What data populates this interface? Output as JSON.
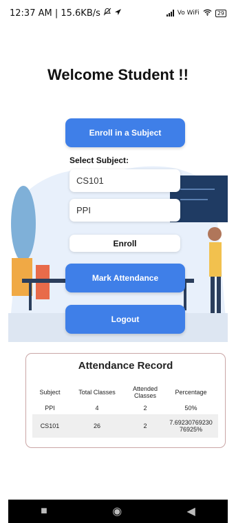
{
  "status_bar": {
    "time_speed": "12:37 AM | 15.6KB/s",
    "mute_icon": "bell-off-icon",
    "nav_arrow_icon": "navigation-arrow-icon",
    "vowifi": "Vo WiFi",
    "battery": "29"
  },
  "header": {
    "title": "Welcome Student !!"
  },
  "enroll_section": {
    "enroll_subject_label": "Enroll in a Subject",
    "select_subject_label": "Select Subject:",
    "subject_input_1": "CS101",
    "subject_input_2": "PPI",
    "enroll_label": "Enroll"
  },
  "actions": {
    "mark_attendance_label": "Mark Attendance",
    "logout_label": "Logout"
  },
  "attendance": {
    "title": "Attendance Record",
    "columns": [
      "Subject",
      "Total Classes",
      "Attended Classes",
      "Percentage"
    ],
    "rows": [
      [
        "PPI",
        "4",
        "2",
        "50%"
      ],
      [
        "CS101",
        "26",
        "2",
        "7.69230769230 76925%"
      ]
    ]
  },
  "nav": {
    "recent_icon": "square-icon",
    "home_icon": "circle-icon",
    "back_icon": "triangle-back-icon"
  },
  "colors": {
    "accent": "#3f7fe8",
    "card_border": "#c9a5a5"
  }
}
